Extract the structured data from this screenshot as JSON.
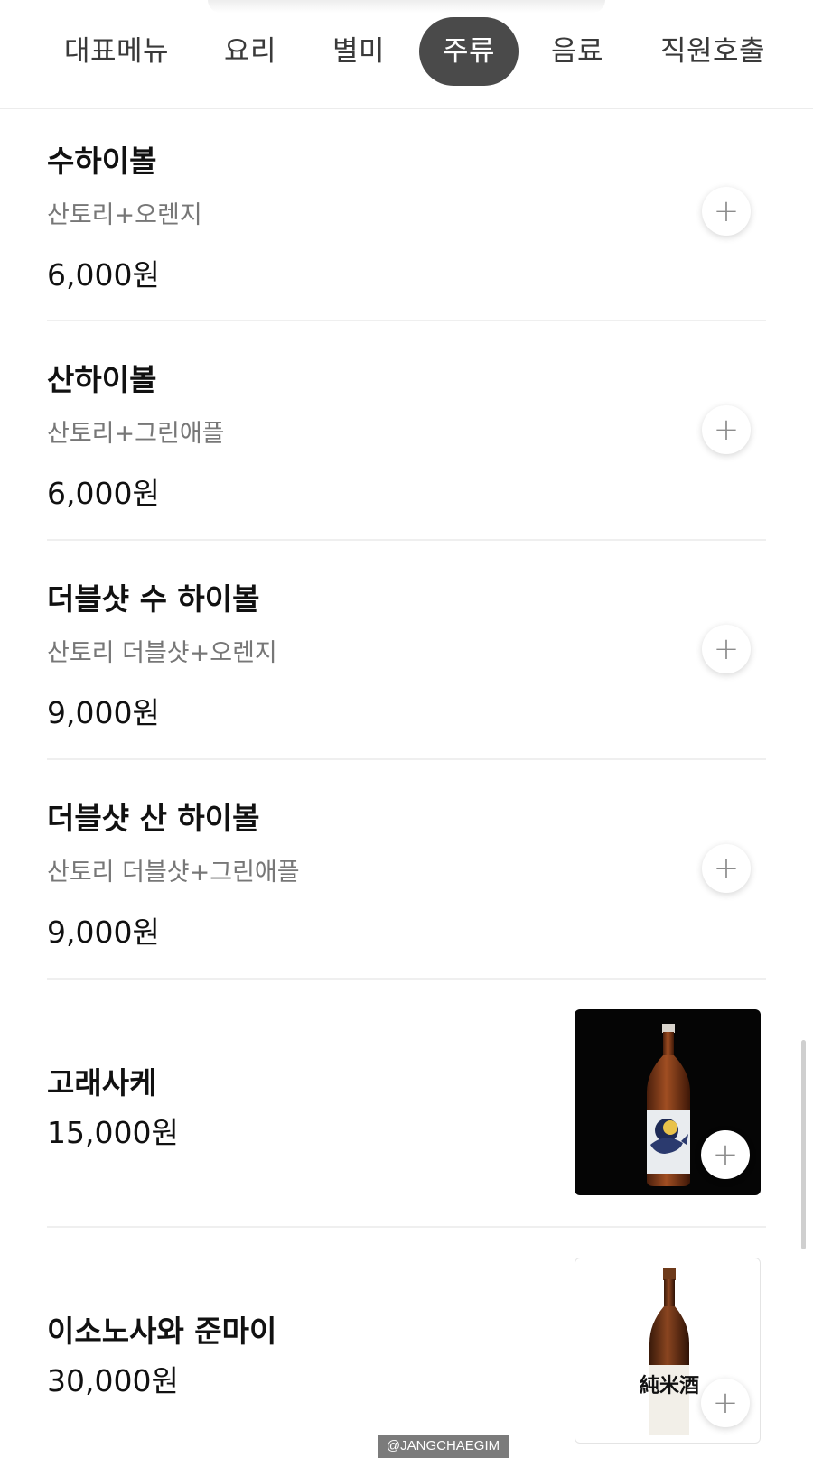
{
  "tabs": [
    {
      "label": "대표메뉴",
      "active": false
    },
    {
      "label": "요리",
      "active": false
    },
    {
      "label": "별미",
      "active": false
    },
    {
      "label": "주류",
      "active": true
    },
    {
      "label": "음료",
      "active": false
    },
    {
      "label": "직원호출",
      "active": false
    }
  ],
  "items": [
    {
      "name": "수하이볼",
      "desc": "산토리+오렌지",
      "price": "6,000원",
      "add_icon": "+"
    },
    {
      "name": "산하이볼",
      "desc": "산토리+그린애플",
      "price": "6,000원",
      "add_icon": "+"
    },
    {
      "name": "더블샷 수 하이볼",
      "desc": "산토리 더블샷+오렌지",
      "price": "9,000원",
      "add_icon": "+"
    },
    {
      "name": "더블샷 산 하이볼",
      "desc": "산토리 더블샷+그린애플",
      "price": "9,000원",
      "add_icon": "+"
    },
    {
      "name": "고래사케",
      "price": "15,000원",
      "add_icon": "+",
      "image": "whale-sake-bottle"
    },
    {
      "name": "이소노사와 준마이",
      "price": "30,000원",
      "add_icon": "+",
      "image": "junmai-sake-bottle",
      "bottle_label": "純米酒"
    }
  ],
  "watermark": "@JANGCHAEGIM",
  "colors": {
    "active_tab_bg": "#4a4a4a",
    "desc_text": "#777777",
    "divider": "#efefef"
  }
}
